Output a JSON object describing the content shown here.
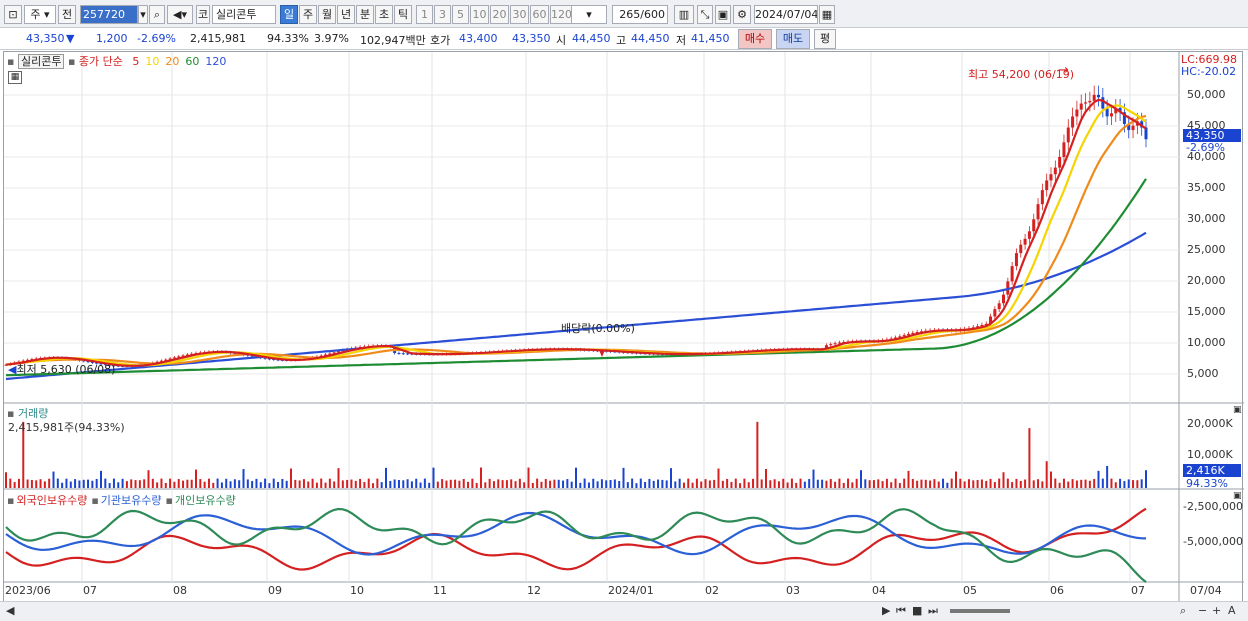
{
  "toolbar": {
    "market_select": "주",
    "prev_label": "전",
    "stock_code": "257720",
    "market_badge": "코",
    "stock_name": "실리콘투",
    "periods": [
      "일",
      "주",
      "월",
      "년",
      "분",
      "초",
      "틱"
    ],
    "active_period": "일",
    "intervals": [
      "1",
      "3",
      "5",
      "10",
      "20",
      "30",
      "60",
      "120"
    ],
    "count_value": "265",
    "count_total": "/600",
    "date": "2024/07/04"
  },
  "info": {
    "price": "43,350",
    "arrow": "▼",
    "change": "1,200",
    "change_pct": "-2.69%",
    "volume": "2,415,981",
    "vol_ratio": "94.33%",
    "turnover": "3.97%",
    "amount": "102,947백만",
    "quote_label": "호가",
    "ask": "43,400",
    "bid": "43,350",
    "open_label": "시",
    "open": "44,450",
    "high_label": "고",
    "high": "44,450",
    "low_label": "저",
    "low": "41,450",
    "buy_label": "매수",
    "sell_label": "매도",
    "eval_label": "평"
  },
  "price_panel": {
    "stock_label": "실리콘투",
    "ma_title": "종가 단순",
    "ma_periods": [
      "5",
      "10",
      "20",
      "60",
      "120"
    ],
    "ma_colors": [
      "#d42020",
      "#f5d400",
      "#f08a1a",
      "#1e8c32",
      "#2a4fd6"
    ],
    "lc": "LC:669.98",
    "hc": "HC:-20.02",
    "current_tag": "43,350",
    "current_pct": "-2.69%",
    "max_note": "최고 54,200 (06/19)",
    "min_note": "최저 5,630 (06/08)",
    "dividend_note": "배당락(0.00%)",
    "y_ticks": [
      "50,000",
      "45,000",
      "40,000",
      "35,000",
      "30,000",
      "25,000",
      "20,000",
      "15,000",
      "10,000",
      "5,000"
    ]
  },
  "volume_panel": {
    "title": "거래량",
    "value": "2,415,981주(94.33%)",
    "y_ticks": [
      "20,000K",
      "10,000K"
    ],
    "tag": "2,416K",
    "pct": "94.33%"
  },
  "holding_panel": {
    "series": [
      "외국인보유수량",
      "기관보유수량",
      "개인보유수량"
    ],
    "colors": [
      "#d42020",
      "#2a5fd6",
      "#2e8b57"
    ],
    "y_ticks": [
      "-2,500,000",
      "-5,000,000"
    ]
  },
  "x_labels": [
    "2023/06",
    "07",
    "08",
    "09",
    "10",
    "11",
    "12",
    "2024/01",
    "02",
    "03",
    "04",
    "05",
    "06",
    "07",
    "07/04"
  ]
}
